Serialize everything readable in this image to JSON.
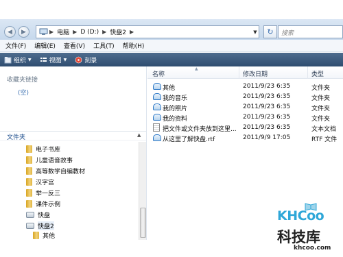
{
  "address_bar": {
    "crumbs": [
      "电脑",
      "D (D:)",
      "快盘2"
    ],
    "search_placeholder": "搜索"
  },
  "menu": [
    "文件(F)",
    "编辑(E)",
    "查看(V)",
    "工具(T)",
    "帮助(H)"
  ],
  "toolbar": {
    "organize": "组织",
    "views": "视图",
    "burn": "刻录"
  },
  "nav_pane": {
    "favorites_header": "收藏夹链接",
    "favorites_empty": "(空)",
    "folders_label": "文件夹",
    "tree": [
      {
        "label": "电子书库",
        "kind": "folder"
      },
      {
        "label": "儿童语音故事",
        "kind": "folder"
      },
      {
        "label": "高等数学自编教材",
        "kind": "folder"
      },
      {
        "label": "汉字宫",
        "kind": "folder"
      },
      {
        "label": "举一反三",
        "kind": "folder"
      },
      {
        "label": "课件示例",
        "kind": "folder"
      },
      {
        "label": "快盘",
        "kind": "drive"
      },
      {
        "label": "快盘2",
        "kind": "drive",
        "selected": true
      },
      {
        "label": "其他",
        "kind": "folder"
      }
    ]
  },
  "file_list": {
    "columns": {
      "name": "名称",
      "date": "修改日期",
      "type": "类型"
    },
    "rows": [
      {
        "name": "其他",
        "date": "2011/9/23 6:35",
        "type": "文件夹",
        "icon": "folder"
      },
      {
        "name": "我的音乐",
        "date": "2011/9/23 6:35",
        "type": "文件夹",
        "icon": "folder"
      },
      {
        "name": "我的照片",
        "date": "2011/9/23 6:35",
        "type": "文件夹",
        "icon": "folder"
      },
      {
        "name": "我的资料",
        "date": "2011/9/23 6:35",
        "type": "文件夹",
        "icon": "folder"
      },
      {
        "name": "把文件或文件夹放到这里...",
        "date": "2011/9/23 6:35",
        "type": "文本文档",
        "icon": "text"
      },
      {
        "name": "从这里了解快盘.rtf",
        "date": "2011/9/9 17:05",
        "type": "RTF 文件",
        "icon": "rtf"
      }
    ]
  },
  "watermark": {
    "logo": "KHCoo",
    "name": "科技库",
    "url": "khcoo.com"
  }
}
